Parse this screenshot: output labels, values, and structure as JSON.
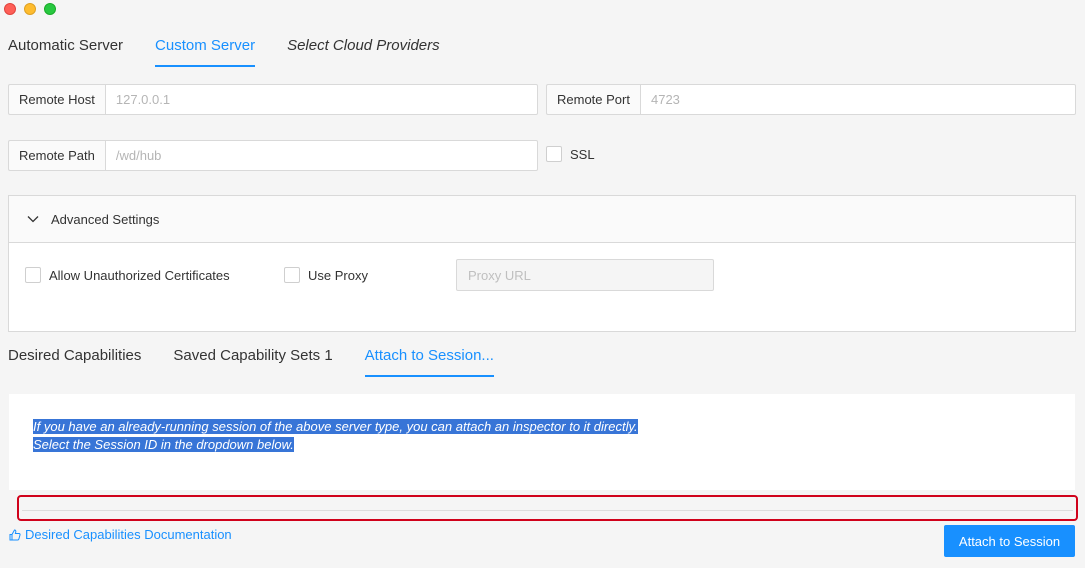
{
  "window": {
    "controls": [
      "close",
      "minimize",
      "zoom"
    ]
  },
  "server_tabs": [
    {
      "label": "Automatic Server",
      "active": false
    },
    {
      "label": "Custom Server",
      "active": true
    },
    {
      "label": "Select Cloud Providers",
      "active": false
    }
  ],
  "remote": {
    "host_label": "Remote Host",
    "host_placeholder": "127.0.0.1",
    "port_label": "Remote Port",
    "port_placeholder": "4723",
    "path_label": "Remote Path",
    "path_placeholder": "/wd/hub",
    "ssl_label": "SSL"
  },
  "advanced": {
    "title": "Advanced Settings",
    "allow_unauthorized_label": "Allow Unauthorized Certificates",
    "use_proxy_label": "Use Proxy",
    "proxy_placeholder": "Proxy URL"
  },
  "capability_tabs": [
    {
      "label": "Desired Capabilities",
      "active": false
    },
    {
      "label": "Saved Capability Sets 1",
      "active": false
    },
    {
      "label": "Attach to Session...",
      "active": true
    }
  ],
  "attach": {
    "line1": "If you have an already-running session of the above server type, you can attach an inspector to it directly.",
    "line2": "Select the Session ID in the dropdown below."
  },
  "footer": {
    "doc_link": "Desired Capabilities Documentation",
    "attach_button": "Attach to Session"
  },
  "colors": {
    "accent": "#1890ff",
    "highlight": "#d0021b",
    "selection": "#3875d7"
  }
}
